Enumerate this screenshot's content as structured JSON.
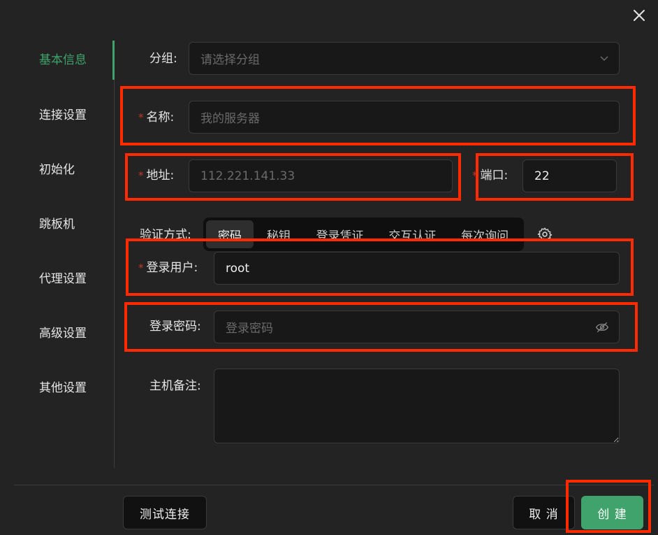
{
  "sidebar": {
    "items": [
      {
        "label": "基本信息",
        "active": true
      },
      {
        "label": "连接设置"
      },
      {
        "label": "初始化"
      },
      {
        "label": "跳板机"
      },
      {
        "label": "代理设置"
      },
      {
        "label": "高级设置"
      },
      {
        "label": "其他设置"
      }
    ]
  },
  "form": {
    "group": {
      "label": "分组:",
      "placeholder": "请选择分组"
    },
    "name": {
      "label": "名称:",
      "placeholder": "我的服务器"
    },
    "address": {
      "label": "地址:",
      "value": "112.221.141.33"
    },
    "port": {
      "label": "端口:",
      "value": "22"
    },
    "auth": {
      "label": "验证方式:",
      "options": [
        "密码",
        "秘钥",
        "登录凭证",
        "交互认证",
        "每次询问"
      ],
      "selected": "密码"
    },
    "username": {
      "label": "登录用户:",
      "value": "root"
    },
    "password": {
      "label": "登录密码:",
      "placeholder": "登录密码"
    },
    "notes": {
      "label": "主机备注:",
      "value": ""
    }
  },
  "footer": {
    "test_label": "测试连接",
    "cancel_label": "取 消",
    "create_label": "创 建"
  },
  "colors": {
    "accent": "#3fa36b",
    "annotation": "#ff2a00",
    "required": "#c0392b"
  },
  "required_mark": "*"
}
